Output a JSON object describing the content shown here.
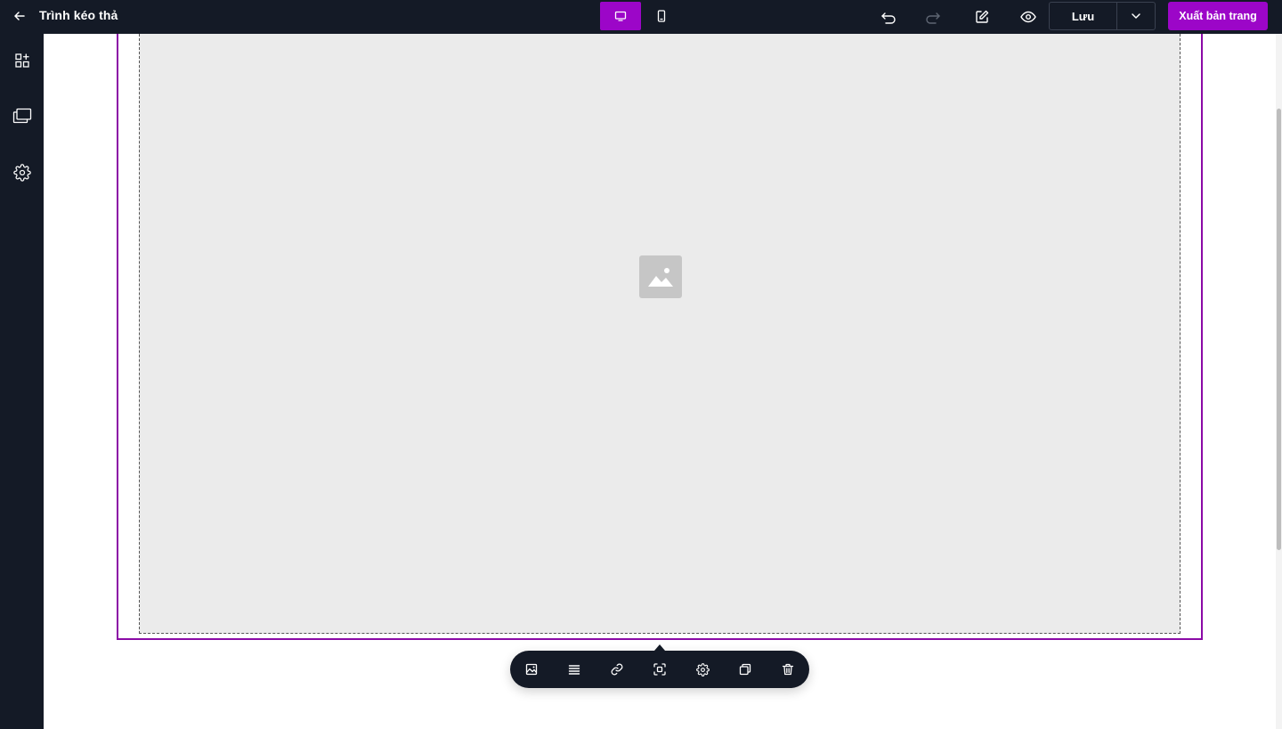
{
  "header": {
    "title": "Trình kéo thả",
    "save_label": "Lưu",
    "publish_label": "Xuất bản trang",
    "icons": {
      "back": "arrow-left-icon",
      "desktop": "desktop-icon",
      "mobile": "mobile-icon",
      "undo": "undo-icon",
      "redo": "redo-icon",
      "edit": "edit-icon",
      "preview": "eye-icon",
      "save_dropdown": "chevron-down-icon"
    },
    "active_device": "desktop"
  },
  "sidebar": {
    "items": [
      {
        "icon": "elements-grid-icon"
      },
      {
        "icon": "pages-icon"
      },
      {
        "icon": "gear-icon"
      }
    ]
  },
  "canvas": {
    "image_placeholder_icon": "image-icon"
  },
  "element_toolbar": {
    "items": [
      {
        "icon": "image-icon"
      },
      {
        "icon": "align-icon"
      },
      {
        "icon": "link-icon"
      },
      {
        "icon": "focus-icon"
      },
      {
        "icon": "gear-icon"
      },
      {
        "icon": "duplicate-icon"
      },
      {
        "icon": "trash-icon"
      }
    ]
  },
  "colors": {
    "accent": "#9c06c8",
    "topbar_bg": "#141a26",
    "section_border": "#8b0aa6",
    "image_bg": "#ebebeb"
  }
}
